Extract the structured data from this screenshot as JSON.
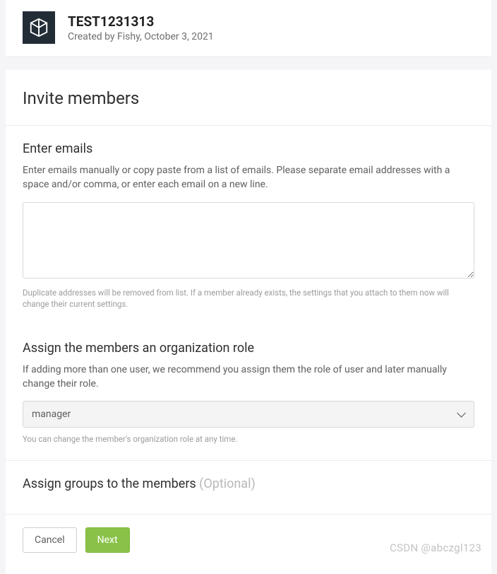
{
  "header": {
    "title": "TEST1231313",
    "subtitle": "Created by Fishy, October 3, 2021"
  },
  "page": {
    "title": "Invite members"
  },
  "emails": {
    "heading": "Enter emails",
    "desc": "Enter emails manually or copy paste from a list of emails. Please separate email addresses with a space and/or comma, or enter each email on a new line.",
    "value": "",
    "hint": "Duplicate addresses will be removed from list. If a member already exists, the settings that you attach to them now will change their current settings."
  },
  "role": {
    "heading": "Assign the members an organization role",
    "desc": "If adding more than one user, we recommend you assign them the role of user and later manually change their role.",
    "selected": "manager",
    "hint": "You can change the member's organization role at any time."
  },
  "groups": {
    "heading": "Assign groups to the members ",
    "optional": "(Optional)"
  },
  "actions": {
    "cancel": "Cancel",
    "next": "Next"
  },
  "watermark": "CSDN @abczgl123"
}
